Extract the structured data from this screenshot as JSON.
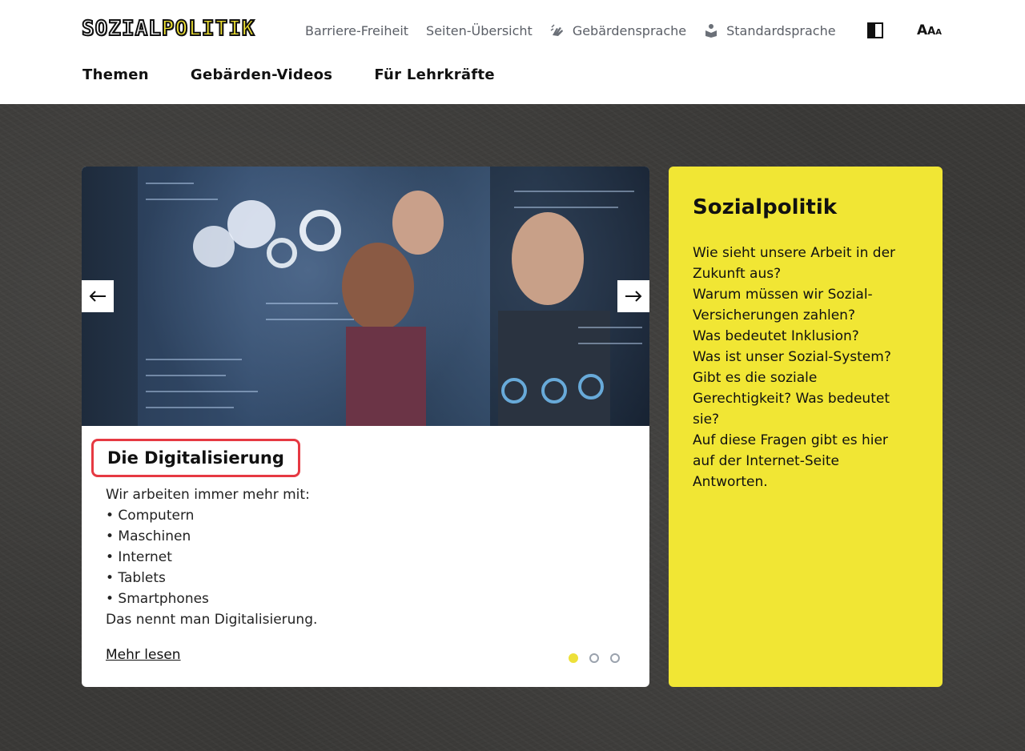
{
  "header": {
    "logo": {
      "part1": "SOZIAL",
      "part2": "POLITIK"
    },
    "topnav": [
      {
        "label": "Barriere-Freiheit",
        "icon": ""
      },
      {
        "label": "Seiten-Übersicht",
        "icon": ""
      },
      {
        "label": "Gebärdensprache",
        "icon": "sign-language-hand-icon"
      },
      {
        "label": "Standardsprache",
        "icon": "reading-person-icon"
      }
    ],
    "contrast_icon": "contrast-toggle-icon",
    "font_size": {
      "a1": "A",
      "a2": "A",
      "a3": "A"
    },
    "mainnav": [
      "Themen",
      "Gebärden-Videos",
      "Für Lehrkräfte"
    ]
  },
  "carousel": {
    "prev_icon": "arrow-left-icon",
    "next_icon": "arrow-right-icon",
    "title": "Die Digitalisierung",
    "intro": "Wir arbeiten immer mehr mit:",
    "bullets": [
      "• Computern",
      "• Maschinen",
      "• Internet",
      "• Tablets",
      "• Smartphones"
    ],
    "outro": "Das nennt man Digitalisierung.",
    "more_link": "Mehr lesen",
    "slides": 3,
    "active_slide": 1,
    "accent_color": "#ede03a",
    "highlight_color": "#e63942"
  },
  "info": {
    "title": "Sozialpolitik",
    "lines": [
      "Wie sieht unsere Arbeit in der",
      "Zukunft aus?",
      "Warum müssen wir Sozial-",
      "Versicherungen zahlen?",
      "Was bedeutet Inklusion?",
      "Was ist unser Sozial-System?",
      "Gibt es die soziale",
      "Gerechtigkeit? Was bedeutet",
      "sie?",
      "Auf diese Fragen gibt es hier",
      "auf der Internet-Seite",
      "Antworten."
    ],
    "background": "#f1e634"
  }
}
